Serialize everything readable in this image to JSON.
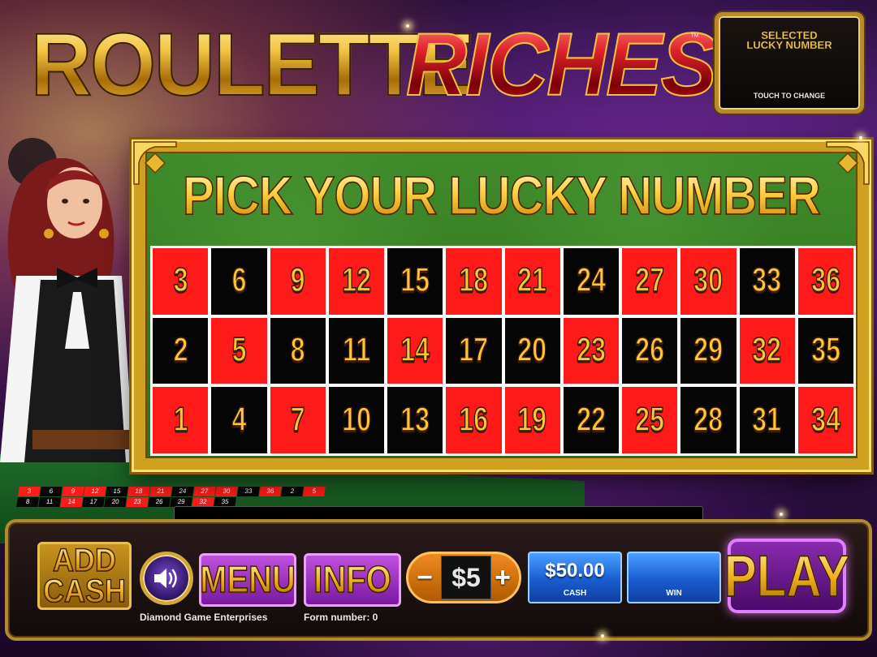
{
  "logo": {
    "word1": "ROULETTE",
    "word2": "RICHES",
    "trademark": "™"
  },
  "selected_plaque": {
    "title_line1": "SELECTED",
    "title_line2": "LUCKY NUMBER",
    "subtitle": "TOUCH TO CHANGE"
  },
  "picker": {
    "title": "PICK YOUR LUCKY NUMBER",
    "rows": [
      [
        {
          "n": "3",
          "color": "red"
        },
        {
          "n": "6",
          "color": "black"
        },
        {
          "n": "9",
          "color": "red"
        },
        {
          "n": "12",
          "color": "red"
        },
        {
          "n": "15",
          "color": "black"
        },
        {
          "n": "18",
          "color": "red"
        },
        {
          "n": "21",
          "color": "red"
        },
        {
          "n": "24",
          "color": "black"
        },
        {
          "n": "27",
          "color": "red"
        },
        {
          "n": "30",
          "color": "red"
        },
        {
          "n": "33",
          "color": "black"
        },
        {
          "n": "36",
          "color": "red"
        }
      ],
      [
        {
          "n": "2",
          "color": "black"
        },
        {
          "n": "5",
          "color": "red"
        },
        {
          "n": "8",
          "color": "black"
        },
        {
          "n": "11",
          "color": "black"
        },
        {
          "n": "14",
          "color": "red"
        },
        {
          "n": "17",
          "color": "black"
        },
        {
          "n": "20",
          "color": "black"
        },
        {
          "n": "23",
          "color": "red"
        },
        {
          "n": "26",
          "color": "black"
        },
        {
          "n": "29",
          "color": "black"
        },
        {
          "n": "32",
          "color": "red"
        },
        {
          "n": "35",
          "color": "black"
        }
      ],
      [
        {
          "n": "1",
          "color": "red"
        },
        {
          "n": "4",
          "color": "black"
        },
        {
          "n": "7",
          "color": "red"
        },
        {
          "n": "10",
          "color": "black"
        },
        {
          "n": "13",
          "color": "black"
        },
        {
          "n": "16",
          "color": "red"
        },
        {
          "n": "19",
          "color": "red"
        },
        {
          "n": "22",
          "color": "black"
        },
        {
          "n": "25",
          "color": "red"
        },
        {
          "n": "28",
          "color": "black"
        },
        {
          "n": "31",
          "color": "black"
        },
        {
          "n": "34",
          "color": "red"
        }
      ]
    ]
  },
  "console": {
    "add_cash_line1": "ADD",
    "add_cash_line2": "CASH",
    "volume_icon": "speaker-icon",
    "menu_label": "MENU",
    "info_label": "INFO",
    "bet_minus": "−",
    "bet_value": "$5",
    "bet_plus": "+",
    "cash_value": "$50.00",
    "cash_label": "CASH",
    "win_value": "",
    "win_label": "WIN",
    "play_label": "PLAY",
    "company": "Diamond Game Enterprises",
    "form_number": "Form number: 0"
  },
  "colors": {
    "red": "#ff1a1a",
    "black": "#060606",
    "gold": "#ffc437",
    "felt": "#2e7420",
    "purple": "#7a18a0",
    "blue": "#1a5cd0"
  }
}
